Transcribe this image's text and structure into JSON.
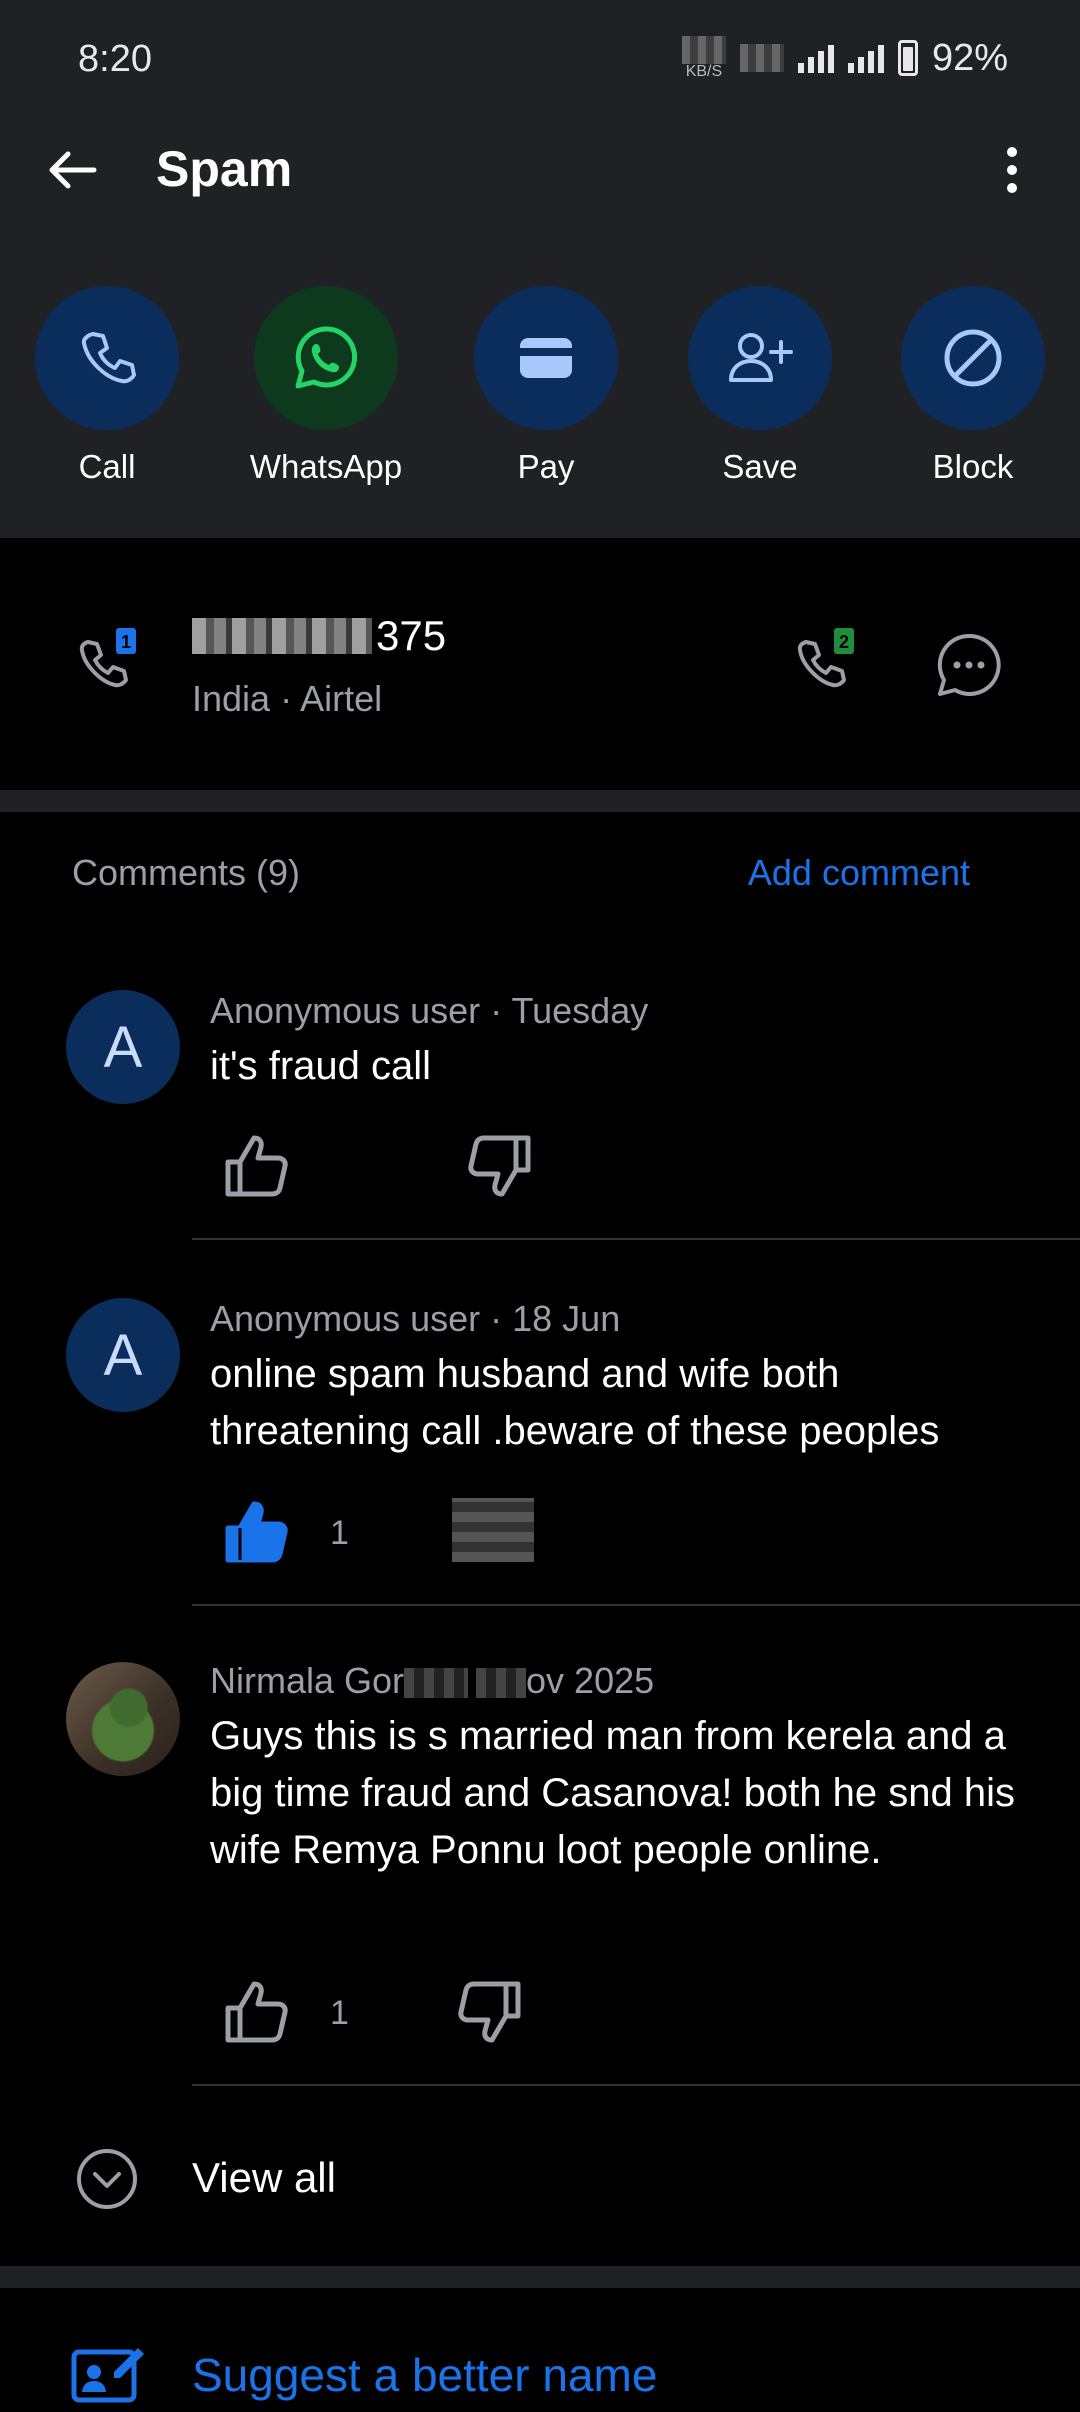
{
  "status": {
    "time": "8:20",
    "netspeed": "KB/S",
    "battery": "92%"
  },
  "appbar": {
    "title": "Spam"
  },
  "actions": [
    {
      "label": "Call",
      "icon": "phone-icon"
    },
    {
      "label": "WhatsApp",
      "icon": "whatsapp-icon"
    },
    {
      "label": "Pay",
      "icon": "wallet-icon"
    },
    {
      "label": "Save",
      "icon": "add-contact-icon"
    },
    {
      "label": "Block",
      "icon": "block-icon"
    }
  ],
  "number": {
    "value_suffix": "375",
    "carrier": "India · Airtel",
    "sim1": "1",
    "sim2": "2"
  },
  "comments": {
    "header": "Comments (9)",
    "add_label": "Add comment",
    "items": [
      {
        "avatar": "A",
        "meta": "Anonymous user · Tuesday",
        "text": "it's fraud call",
        "likes": ""
      },
      {
        "avatar": "A",
        "meta": "Anonymous user · 18 Jun",
        "text": "online spam husband and wife both threatening call .beware of these peoples",
        "likes": "1"
      },
      {
        "avatar": "",
        "meta_start": "Nirmala Gor",
        "meta_end": "ov 2025",
        "text": "Guys this is s married man from kerela and a big time fraud and Casanova! both he snd his wife Remya Ponnu loot people online.",
        "likes": "1"
      }
    ],
    "view_all": "View all"
  },
  "suggest": {
    "label": "Suggest a better name"
  },
  "colors": {
    "accent": "#1a73e8",
    "circle": "#0b2d5c",
    "whatsapp_circle": "#0d3a1c",
    "top_bg": "#202124"
  }
}
